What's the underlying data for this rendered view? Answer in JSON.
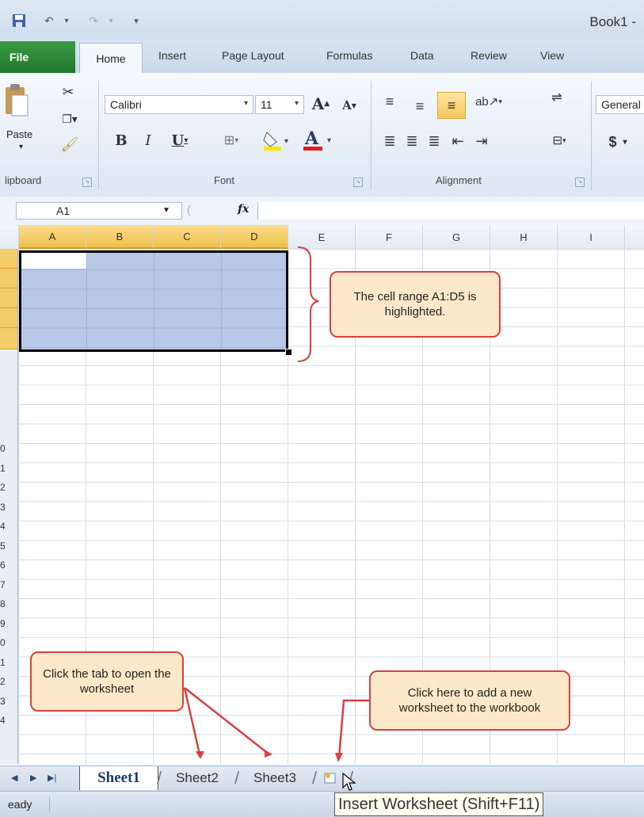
{
  "window": {
    "title": "Book1 -"
  },
  "ribbon_tabs": [
    "File",
    "Home",
    "Insert",
    "Page Layout",
    "Formulas",
    "Data",
    "Review",
    "View"
  ],
  "ribbon": {
    "paste_label": "Paste",
    "font_name": "Calibri",
    "font_size": "11",
    "number_format": "General",
    "currency_symbol": "$",
    "groups": {
      "clipboard": "lipboard",
      "font": "Font",
      "alignment": "Alignment"
    }
  },
  "formula_bar": {
    "name_box": "A1",
    "fx_label": "fx",
    "value": ""
  },
  "columns": [
    "A",
    "B",
    "C",
    "D",
    "E",
    "F",
    "G",
    "H",
    "I"
  ],
  "selected_columns": [
    "A",
    "B",
    "C",
    "D"
  ],
  "row_labels": [
    "0",
    "1",
    "2",
    "3",
    "4",
    "5",
    "6",
    "7",
    "8",
    "9",
    "0",
    "1",
    "2",
    "3",
    "4"
  ],
  "callouts": {
    "range": "The cell range A1:D5 is highlighted.",
    "tab": "Click the tab to open the worksheet",
    "new_sheet": "Click here to add a new worksheet to the workbook"
  },
  "sheets": [
    {
      "name": "Sheet1",
      "active": true
    },
    {
      "name": "Sheet2",
      "active": false
    },
    {
      "name": "Sheet3",
      "active": false
    }
  ],
  "status": {
    "text": "eady"
  },
  "tooltip": "Insert Worksheet (Shift+F11)",
  "colors": {
    "selection": "#b8c8e6",
    "callout_fill": "#fde9c9",
    "callout_border": "#d94040",
    "file_tab": "#2a8a36"
  }
}
